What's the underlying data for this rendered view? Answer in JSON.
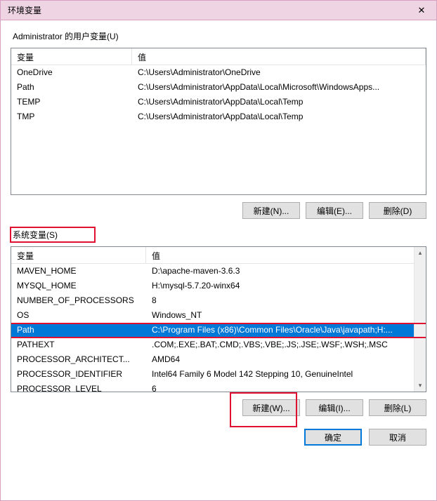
{
  "window": {
    "title": "环境变量",
    "close_glyph": "✕"
  },
  "user_section": {
    "label": "Administrator 的用户变量(U)",
    "columns": {
      "name": "变量",
      "value": "值"
    },
    "rows": [
      {
        "name": "OneDrive",
        "value": "C:\\Users\\Administrator\\OneDrive"
      },
      {
        "name": "Path",
        "value": "C:\\Users\\Administrator\\AppData\\Local\\Microsoft\\WindowsApps..."
      },
      {
        "name": "TEMP",
        "value": "C:\\Users\\Administrator\\AppData\\Local\\Temp"
      },
      {
        "name": "TMP",
        "value": "C:\\Users\\Administrator\\AppData\\Local\\Temp"
      }
    ],
    "buttons": {
      "new": "新建(N)...",
      "edit": "编辑(E)...",
      "delete": "删除(D)"
    }
  },
  "system_section": {
    "label": "系统变量(S)",
    "columns": {
      "name": "变量",
      "value": "值"
    },
    "rows": [
      {
        "name": "MAVEN_HOME",
        "value": "D:\\apache-maven-3.6.3"
      },
      {
        "name": "MYSQL_HOME",
        "value": "H:\\mysql-5.7.20-winx64"
      },
      {
        "name": "NUMBER_OF_PROCESSORS",
        "value": "8"
      },
      {
        "name": "OS",
        "value": "Windows_NT"
      },
      {
        "name": "Path",
        "value": "C:\\Program Files (x86)\\Common Files\\Oracle\\Java\\javapath;H:...",
        "selected": true
      },
      {
        "name": "PATHEXT",
        "value": ".COM;.EXE;.BAT;.CMD;.VBS;.VBE;.JS;.JSE;.WSF;.WSH;.MSC"
      },
      {
        "name": "PROCESSOR_ARCHITECT...",
        "value": "AMD64"
      },
      {
        "name": "PROCESSOR_IDENTIFIER",
        "value": "Intel64 Family 6 Model 142 Stepping 10, GenuineIntel"
      },
      {
        "name": "PROCESSOR_LEVEL",
        "value": "6"
      }
    ],
    "buttons": {
      "new": "新建(W)...",
      "edit": "编辑(I)...",
      "delete": "删除(L)"
    }
  },
  "footer": {
    "ok": "确定",
    "cancel": "取消"
  }
}
